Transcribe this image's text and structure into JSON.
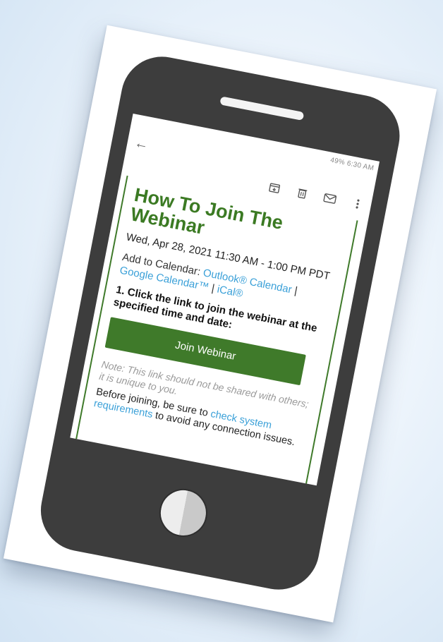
{
  "status_bar": {
    "text": "49% 6:30 AM"
  },
  "toolbar": {
    "back_icon": "arrow-left-icon",
    "actions": [
      "archive-icon",
      "delete-icon",
      "mail-icon",
      "more-vert-icon"
    ]
  },
  "email": {
    "title": "How To Join The Webinar",
    "date_time": "Wed, Apr 28, 2021 11:30 AM - 1:00 PM PDT",
    "calendar_prefix": "Add to Calendar: ",
    "calendar_links": {
      "outlook": "Outlook® Calendar",
      "separator_1": " | ",
      "google": "Google Calendar™",
      "separator_2": " | ",
      "ical": "iCal®"
    },
    "step_1": "1. Click the link to join the webinar at the specified time and date:",
    "join_button": "Join Webinar",
    "note": "Note: This link should not be shared with others; it is unique to you.",
    "before_prefix": "Before joining, be sure to ",
    "before_link": "check system requirements",
    "before_suffix": " to avoid any connection issues."
  },
  "colors": {
    "accent_green": "#3f7a2a",
    "link_blue": "#3aa0d8",
    "phone_body": "#3d3d3d",
    "background": "#dbe9f6"
  }
}
